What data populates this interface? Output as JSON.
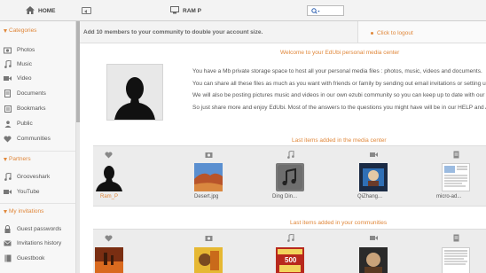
{
  "topbar": {
    "home_label": "HOME",
    "user_label": "RAM P",
    "search_value": ""
  },
  "sidebar": {
    "sections": [
      {
        "title": "Categories",
        "items": [
          "Photos",
          "Music",
          "Video",
          "Documents",
          "Bookmarks",
          "Public",
          "Communities"
        ]
      },
      {
        "title": "Partners",
        "items": [
          "Grooveshark",
          "YouTube"
        ]
      },
      {
        "title": "My invitations",
        "items": [
          "Guest passwords",
          "Invitations history",
          "Guestbook"
        ]
      }
    ]
  },
  "banner": {
    "text": "Add 10 members to your community to double your account size."
  },
  "logout": {
    "label": "Click to logout"
  },
  "welcome": {
    "title": "Welcome to your EdUbi personal media center",
    "lines": [
      "You have a Mb private storage space to host all your personal media files : photos, music, videos and documents.",
      "You can share all these files as much as you want with friends or family by sending out email invitations or setting up you",
      "We will also be posting pictures music and videos in our own ezubi community so you can keep up to date with our latest",
      "So just share more and enjoy EdUbi. Most of the answers to the questions you might have will be in our HELP and ASSIS"
    ]
  },
  "media_center": {
    "title": "Last items added in the media center",
    "items": [
      {
        "type_icon": "heart-icon",
        "name": "Ram_P",
        "thumb": "user-silhouette"
      },
      {
        "type_icon": "photo-icon",
        "name": "Desert.jpg",
        "thumb": "desert-photo"
      },
      {
        "type_icon": "music-icon",
        "name": "Ding Din...",
        "thumb": "music-note-tile"
      },
      {
        "type_icon": "video-icon",
        "name": "QiZhang...",
        "thumb": "video-frame"
      },
      {
        "type_icon": "document-icon",
        "name": "micro-ad...",
        "thumb": "document-page"
      }
    ]
  },
  "communities": {
    "title": "Last items added in your communities",
    "items": [
      {
        "type_icon": "heart-icon"
      },
      {
        "type_icon": "photo-icon"
      },
      {
        "type_icon": "music-icon",
        "cover_text": "500"
      },
      {
        "type_icon": "video-icon"
      },
      {
        "type_icon": "document-icon"
      }
    ]
  },
  "colors": {
    "accent": "#e0873a",
    "link_member": "#e0873a",
    "text": "#555555"
  }
}
